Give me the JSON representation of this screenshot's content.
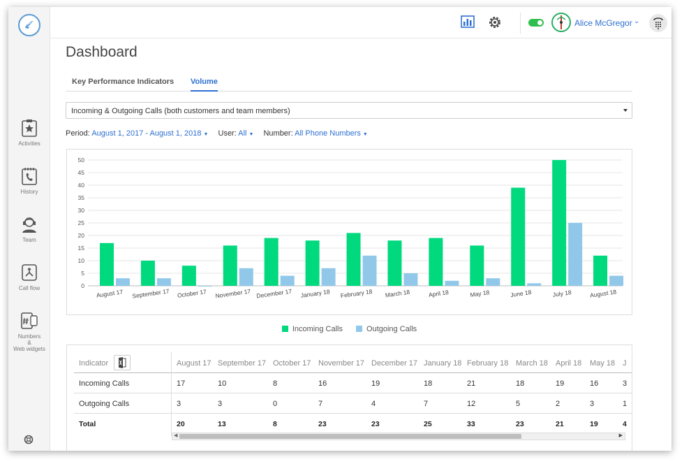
{
  "page": {
    "title": "Dashboard"
  },
  "tabs": [
    {
      "label": "Key Performance Indicators",
      "active": false
    },
    {
      "label": "Volume",
      "active": true
    }
  ],
  "user": {
    "name": "Alice McGregor"
  },
  "sidebar": {
    "items": [
      {
        "label": "Activities",
        "icon": "star-clipboard-icon"
      },
      {
        "label": "History",
        "icon": "phone-calendar-icon"
      },
      {
        "label": "Team",
        "icon": "headset-icon"
      },
      {
        "label": "Call flow",
        "icon": "call-flow-icon"
      },
      {
        "label_lines": [
          "Numbers",
          "&",
          "Web widgets"
        ],
        "icon": "hash-phone-icon"
      }
    ]
  },
  "selector": {
    "value": "Incoming & Outgoing Calls (both customers and team members)"
  },
  "filters": {
    "period_label": "Period:",
    "period_value": "August 1, 2017 - August 1, 2018",
    "user_label": "User:",
    "user_value": "All",
    "number_label": "Number:",
    "number_value": "All Phone Numbers"
  },
  "colors": {
    "incoming": "#00d97e",
    "outgoing": "#91c8ea",
    "accent": "#2d6fd1"
  },
  "chart_data": {
    "type": "bar",
    "categories": [
      "August 17",
      "September 17",
      "October 17",
      "November 17",
      "December 17",
      "January 18",
      "February 18",
      "March 18",
      "April 18",
      "May 18",
      "June 18",
      "July 18",
      "August 18"
    ],
    "series": [
      {
        "name": "Incoming Calls",
        "values": [
          17,
          10,
          8,
          16,
          19,
          18,
          21,
          18,
          19,
          16,
          39,
          50,
          12
        ]
      },
      {
        "name": "Outgoing Calls",
        "values": [
          3,
          3,
          0,
          7,
          4,
          7,
          12,
          5,
          2,
          3,
          1,
          25,
          4
        ]
      }
    ],
    "yticks": [
      0,
      5,
      10,
      15,
      20,
      25,
      30,
      35,
      40,
      45,
      50
    ],
    "ylim": [
      0,
      50
    ],
    "grid": true,
    "legend": "bottom"
  },
  "table": {
    "indicator_header": "Indicator",
    "columns": [
      "August 17",
      "September 17",
      "October 17",
      "November 17",
      "December 17",
      "January 18",
      "February 18",
      "March 18",
      "April 18",
      "May 18",
      "J"
    ],
    "rows": [
      {
        "label": "Incoming Calls",
        "values": [
          "17",
          "10",
          "8",
          "16",
          "19",
          "18",
          "21",
          "18",
          "19",
          "16",
          "3"
        ]
      },
      {
        "label": "Outgoing Calls",
        "values": [
          "3",
          "3",
          "0",
          "7",
          "4",
          "7",
          "12",
          "5",
          "2",
          "3",
          "1"
        ]
      },
      {
        "label": "Total",
        "values": [
          "20",
          "13",
          "8",
          "23",
          "23",
          "25",
          "33",
          "23",
          "21",
          "19",
          "4"
        ]
      }
    ]
  }
}
